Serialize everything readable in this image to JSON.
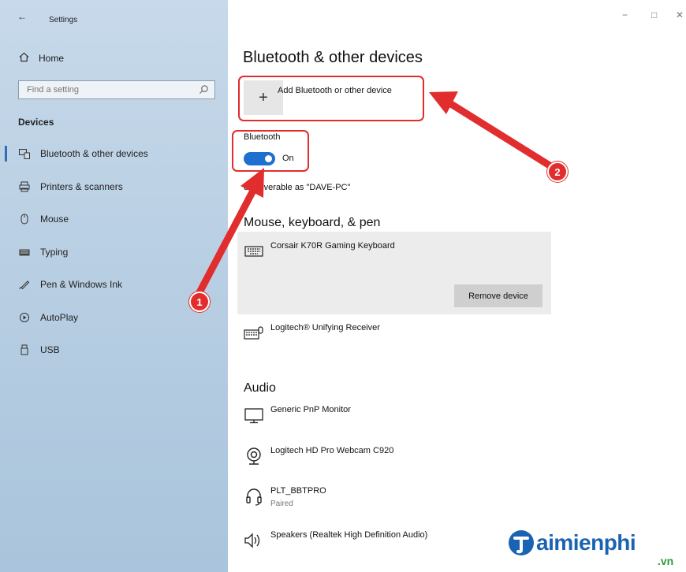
{
  "window": {
    "title": "Settings",
    "back_glyph": "←",
    "minimize_glyph": "−",
    "maximize_glyph": "□",
    "close_glyph": "✕"
  },
  "sidebar": {
    "home_label": "Home",
    "search": {
      "placeholder": "Find a setting",
      "value": ""
    },
    "section": "Devices",
    "items": [
      {
        "label": "Bluetooth & other devices",
        "icon": "bluetooth-devices-icon",
        "active": true
      },
      {
        "label": "Printers & scanners",
        "icon": "printer-icon"
      },
      {
        "label": "Mouse",
        "icon": "mouse-icon"
      },
      {
        "label": "Typing",
        "icon": "keyboard-icon"
      },
      {
        "label": "Pen & Windows Ink",
        "icon": "pen-icon"
      },
      {
        "label": "AutoPlay",
        "icon": "autoplay-icon"
      },
      {
        "label": "USB",
        "icon": "usb-icon"
      }
    ]
  },
  "main": {
    "title": "Bluetooth & other devices",
    "add_button_glyph": "+",
    "add_label": "Add Bluetooth or other device",
    "bluetooth": {
      "label": "Bluetooth",
      "state": "On",
      "discoverable": "discoverable as \"DAVE-PC\""
    },
    "sections": {
      "input": {
        "title": "Mouse, keyboard, & pen",
        "devices": [
          {
            "name": "Corsair K70R Gaming Keyboard",
            "icon": "keyboard-icon",
            "selected": true
          },
          {
            "name": "Logitech® Unifying Receiver",
            "icon": "keyboard-mouse-icon"
          }
        ],
        "remove_label": "Remove device"
      },
      "audio": {
        "title": "Audio",
        "devices": [
          {
            "name": "Generic PnP Monitor",
            "icon": "monitor-icon"
          },
          {
            "name": "Logitech HD Pro Webcam C920",
            "icon": "webcam-icon"
          },
          {
            "name": "PLT_BBTPRO",
            "status": "Paired",
            "icon": "headset-icon"
          },
          {
            "name": "Speakers (Realtek High Definition Audio)",
            "icon": "speaker-icon"
          }
        ]
      }
    }
  },
  "annotations": {
    "badge_1": "1",
    "badge_2": "2",
    "color": "#e12d2d"
  },
  "watermark": {
    "text": "aimienphi",
    "suffix": ".vn",
    "brand_color": "#1a63b3"
  }
}
